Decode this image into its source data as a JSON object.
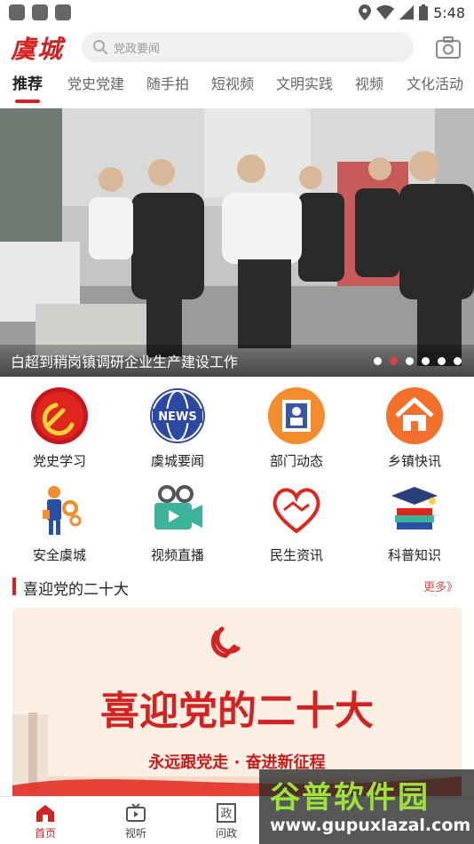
{
  "status_bar": {
    "time": "5:48"
  },
  "header": {
    "logo": "虞城",
    "search_placeholder": "党政要闻"
  },
  "tabs": [
    {
      "label": "推荐",
      "active": true
    },
    {
      "label": "党史党建"
    },
    {
      "label": "随手拍"
    },
    {
      "label": "短视频"
    },
    {
      "label": "文明实践"
    },
    {
      "label": "视频"
    },
    {
      "label": "文化活动"
    }
  ],
  "banner": {
    "title": "白超到稍岗镇调研企业生产建设工作",
    "slide_count": 6,
    "active_index": 1
  },
  "grid": [
    {
      "label": "党史学习",
      "icon": "party-emblem-icon"
    },
    {
      "label": "虞城要闻",
      "icon": "news-globe-icon"
    },
    {
      "label": "部门动态",
      "icon": "department-icon"
    },
    {
      "label": "乡镇快讯",
      "icon": "home-icon"
    },
    {
      "label": "安全虞城",
      "icon": "safety-worker-icon"
    },
    {
      "label": "视频直播",
      "icon": "video-camera-icon"
    },
    {
      "label": "民生资讯",
      "icon": "heart-handshake-icon"
    },
    {
      "label": "科普知识",
      "icon": "graduation-books-icon"
    }
  ],
  "section": {
    "title": "喜迎党的二十大",
    "more": "更多》"
  },
  "poster": {
    "title": "喜迎党的二十大",
    "subtitle": "永远跟党走 · 奋进新征程"
  },
  "bottom_nav": [
    {
      "label": "首页",
      "icon": "home-icon",
      "active": true
    },
    {
      "label": "视听",
      "icon": "tv-icon"
    },
    {
      "label": "问政",
      "icon": "politics-icon"
    }
  ],
  "watermark": {
    "title": "谷普软件园",
    "url": "www.gupuxlazal.com"
  },
  "colors": {
    "accent": "#d32222"
  }
}
